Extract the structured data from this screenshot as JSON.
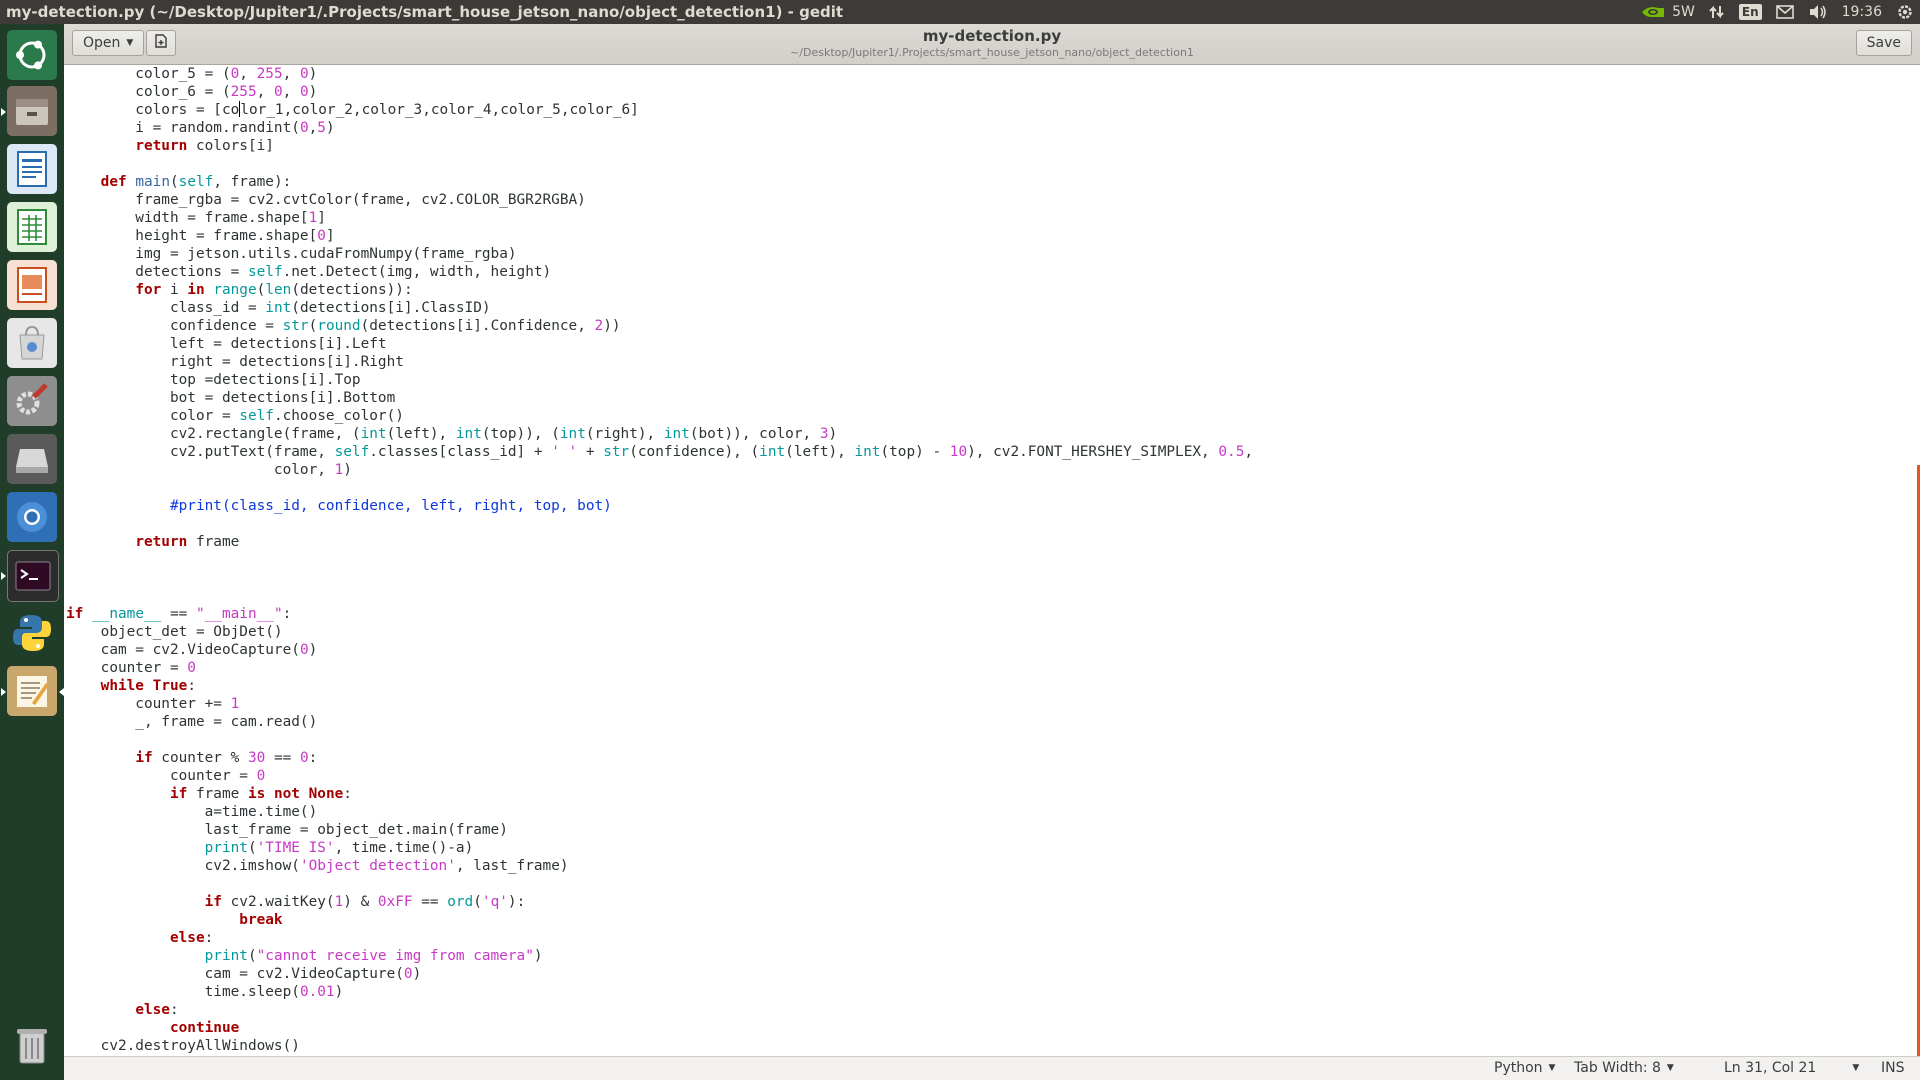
{
  "system_panel": {
    "window_title": "my-detection.py (~/Desktop/Jupiter1/.Projects/smart_house_jetson_nano/object_detection1) - gedit",
    "power_mode": "5W",
    "keyboard_layout": "En",
    "clock": "19:36",
    "icons": [
      "nvidia-icon",
      "network-transfer-icon",
      "mail-icon",
      "volume-icon",
      "settings-gear-icon"
    ]
  },
  "launcher": {
    "items": [
      "ubuntu-dash",
      "files",
      "libreoffice-writer",
      "libreoffice-calc",
      "libreoffice-impress",
      "software-center",
      "system-settings",
      "disk-drive",
      "chromium",
      "terminal",
      "python",
      "text-editor",
      "trash"
    ]
  },
  "headerbar": {
    "open_label": "Open",
    "title": "my-detection.py",
    "subtitle": "~/Desktop/Jupiter1/.Projects/smart_house_jetson_nano/object_detection1",
    "save_label": "Save"
  },
  "editor": {
    "lines": [
      "        color_5 = (0, 255, 0)",
      "        color_6 = (255, 0, 0)",
      "        colors = [color_1,color_2,color_3,color_4,color_5,color_6]",
      "        i = random.randint(0,5)",
      "        return colors[i]",
      "",
      "    def main(self, frame):",
      "        frame_rgba = cv2.cvtColor(frame, cv2.COLOR_BGR2RGBA)",
      "        width = frame.shape[1]",
      "        height = frame.shape[0]",
      "        img = jetson.utils.cudaFromNumpy(frame_rgba)",
      "        detections = self.net.Detect(img, width, height)",
      "        for i in range(len(detections)):",
      "            class_id = int(detections[i].ClassID)",
      "            confidence = str(round(detections[i].Confidence, 2))",
      "            left = detections[i].Left",
      "            right = detections[i].Right",
      "            top =detections[i].Top",
      "            bot = detections[i].Bottom",
      "            color = self.choose_color()",
      "            cv2.rectangle(frame, (int(left), int(top)), (int(right), int(bot)), color, 3)",
      "            cv2.putText(frame, self.classes[class_id] + ' ' + str(confidence), (int(left), int(top) - 10), cv2.FONT_HERSHEY_SIMPLEX, 0.5,",
      "                        color, 1)",
      "",
      "            #print(class_id, confidence, left, right, top, bot)",
      "",
      "        return frame",
      "",
      "",
      "",
      "if __name__ == \"__main__\":",
      "    object_det = ObjDet()",
      "    cam = cv2.VideoCapture(0)",
      "    counter = 0",
      "    while True:",
      "        counter += 1",
      "        _, frame = cam.read()",
      "",
      "        if counter % 30 == 0:",
      "            counter = 0",
      "            if frame is not None:",
      "                a=time.time()",
      "                last_frame = object_det.main(frame)",
      "                print('TIME IS', time.time()-a)",
      "                cv2.imshow('Object detection', last_frame)",
      "",
      "                if cv2.waitKey(1) & 0xFF == ord('q'):",
      "                    break",
      "            else:",
      "                print(\"cannot receive img from camera\")",
      "                cam = cv2.VideoCapture(0)",
      "                time.sleep(0.01)",
      "        else:",
      "            continue",
      "    cv2.destroyAllWindows()"
    ]
  },
  "statusbar": {
    "language": "Python",
    "tab_width": "Tab Width: 8",
    "position": "Ln 31, Col 21",
    "mode": "INS"
  },
  "colors": {
    "panel_bg": "#3c3b37",
    "launcher_bg": "#1f3d29",
    "keyword": "#a40000",
    "number_string": "#c839c5",
    "builtin": "#06989a",
    "comment": "#0c38e0",
    "accent": "#e95420"
  }
}
